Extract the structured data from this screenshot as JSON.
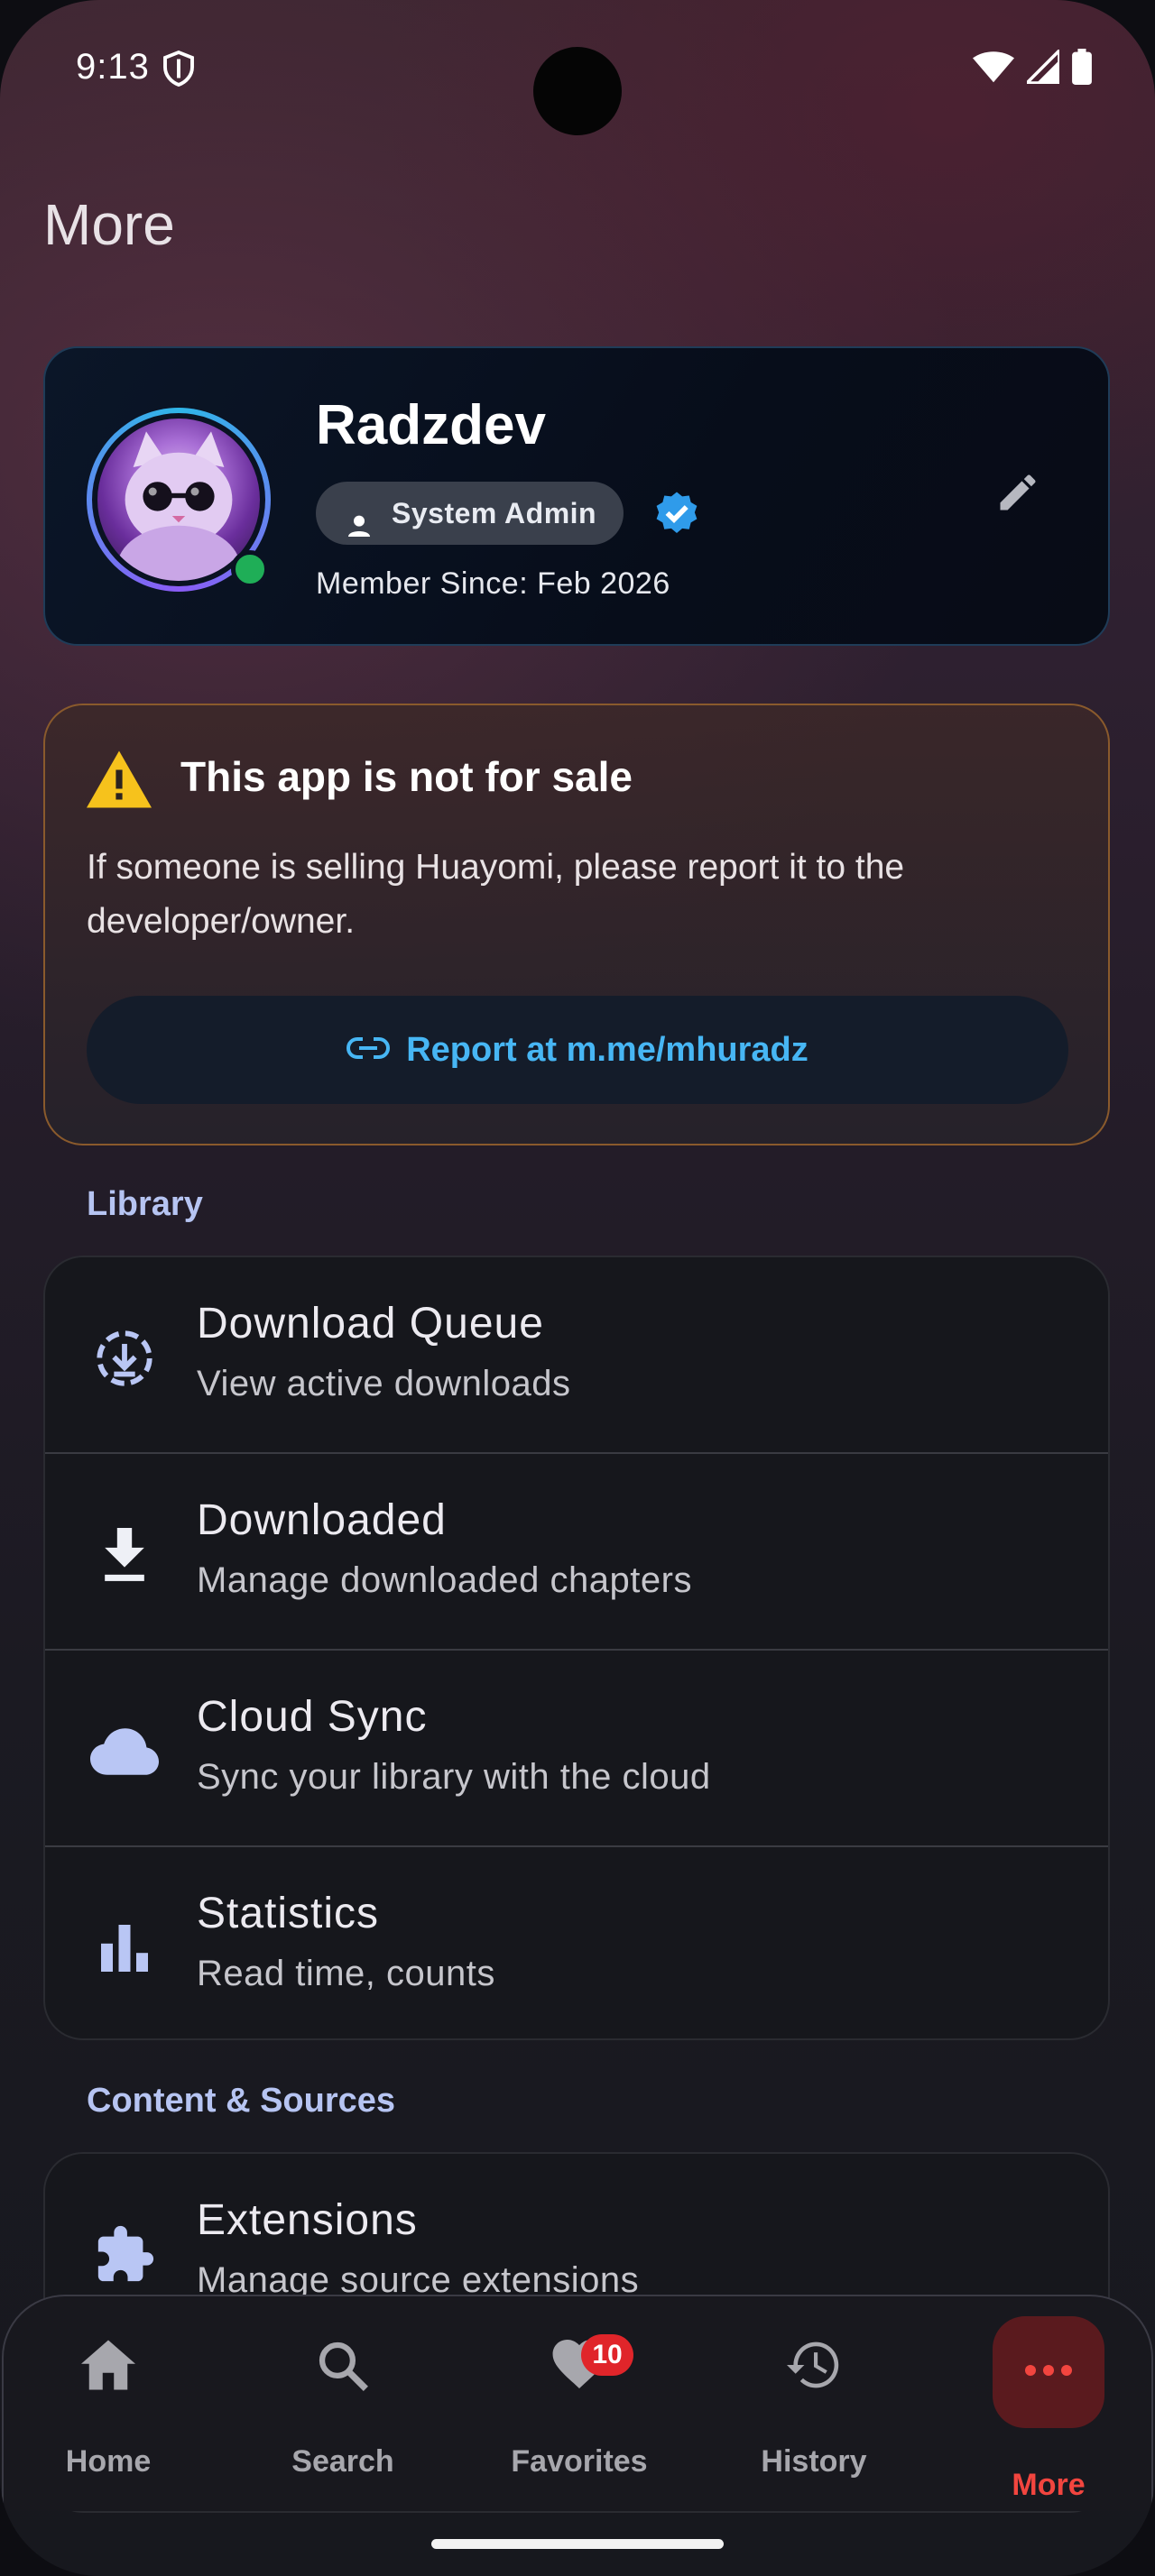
{
  "status_bar": {
    "time": "9:13"
  },
  "page": {
    "title": "More"
  },
  "profile": {
    "name": "Radzdev",
    "role": "System Admin",
    "member_since": "Member Since: Feb 2026"
  },
  "warning": {
    "title": "This app is not for sale",
    "body": "If someone is selling Huayomi, please report it to the developer/owner.",
    "report_label": "Report at m.me/mhuradz"
  },
  "sections": {
    "library": {
      "label": "Library",
      "items": [
        {
          "title": "Download Queue",
          "subtitle": "View active downloads",
          "icon": "download-queue-icon"
        },
        {
          "title": "Downloaded",
          "subtitle": "Manage downloaded chapters",
          "icon": "download-icon"
        },
        {
          "title": "Cloud Sync",
          "subtitle": "Sync your library with the cloud",
          "icon": "cloud-icon"
        },
        {
          "title": "Statistics",
          "subtitle": "Read time, counts",
          "icon": "bar-chart-icon"
        }
      ]
    },
    "content": {
      "label": "Content & Sources",
      "items": [
        {
          "title": "Extensions",
          "subtitle": "Manage source extensions",
          "icon": "puzzle-icon"
        }
      ]
    }
  },
  "bottom_nav": {
    "items": [
      {
        "label": "Home",
        "icon": "home-icon"
      },
      {
        "label": "Search",
        "icon": "search-icon"
      },
      {
        "label": "Favorites",
        "icon": "heart-icon",
        "badge": "10"
      },
      {
        "label": "History",
        "icon": "history-icon"
      },
      {
        "label": "More",
        "icon": "more-icon",
        "active": true
      }
    ]
  },
  "colors": {
    "accent_blue": "#47b6f4",
    "active_red": "#f2453f",
    "online_green": "#1fae57",
    "warning_yellow": "#f6c21c"
  }
}
